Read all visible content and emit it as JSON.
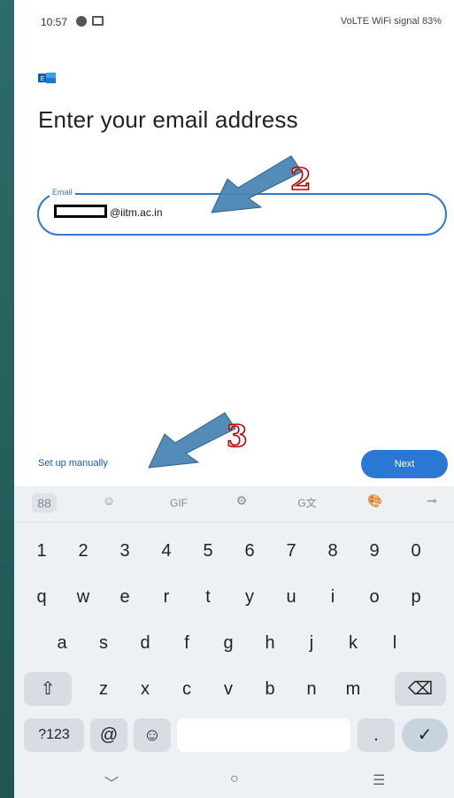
{
  "status_bar": {
    "time": "10:57",
    "right_status": "VoLTE WiFi signal 83%"
  },
  "page": {
    "title": "Enter your email address",
    "email_label": "Email",
    "email_domain": "@iitm.ac.in",
    "setup_manually_label": "Set up manually",
    "next_label": "Next",
    "annotation_2": "2",
    "annotation_3": "3"
  },
  "keyboard": {
    "toolbar": {
      "apps": "88",
      "emoji": "☺",
      "gif": "GIF",
      "settings": "⚙",
      "translate": "G文",
      "palette": "🎨",
      "key": "⊸"
    },
    "number_row": [
      "1",
      "2",
      "3",
      "4",
      "5",
      "6",
      "7",
      "8",
      "9",
      "0"
    ],
    "letter_row_1": [
      "q",
      "w",
      "e",
      "r",
      "t",
      "y",
      "u",
      "i",
      "o",
      "p"
    ],
    "letter_row_2": [
      "a",
      "s",
      "d",
      "f",
      "g",
      "h",
      "j",
      "k",
      "l"
    ],
    "letter_row_3": [
      "z",
      "x",
      "c",
      "v",
      "b",
      "n",
      "m"
    ],
    "bottom_row": {
      "symbols": "?123",
      "at": "@",
      "emoji": "☺",
      "period": ".",
      "enter": "✓"
    }
  },
  "nav_bar": {
    "back": "﹀",
    "home": "○",
    "recents": "☰"
  },
  "colors": {
    "accent": "#2e7ad0",
    "button": "#2b78d4",
    "link": "#1d5aa8",
    "annotation_stroke": "#c00000",
    "arrow_fill": "#4b86b5"
  },
  "icons": {
    "app_logo": "exchange-logo-icon",
    "shift": "shift-icon",
    "backspace": "backspace-icon",
    "enter": "check-icon"
  }
}
